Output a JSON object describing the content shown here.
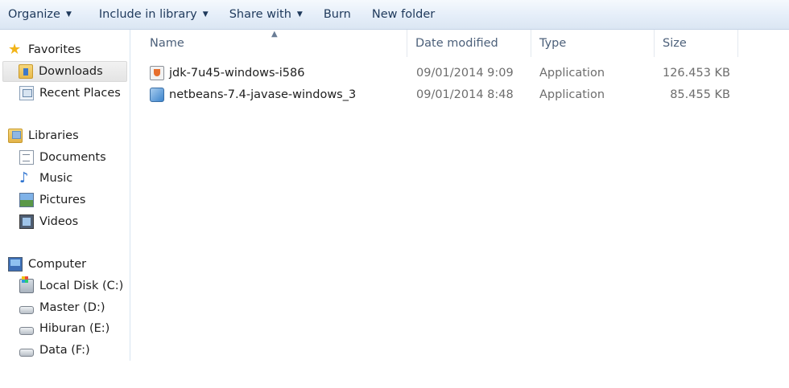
{
  "toolbar": {
    "organize": "Organize",
    "include_in_library": "Include in library",
    "share_with": "Share with",
    "burn": "Burn",
    "new_folder": "New folder"
  },
  "nav": {
    "favorites": {
      "header": "Favorites",
      "items": [
        {
          "label": "Downloads",
          "icon": "downloads-folder-icon",
          "selected": true
        },
        {
          "label": "Recent Places",
          "icon": "recent-places-icon",
          "selected": false
        }
      ]
    },
    "libraries": {
      "header": "Libraries",
      "items": [
        {
          "label": "Documents",
          "icon": "documents-icon"
        },
        {
          "label": "Music",
          "icon": "music-icon"
        },
        {
          "label": "Pictures",
          "icon": "pictures-icon"
        },
        {
          "label": "Videos",
          "icon": "videos-icon"
        }
      ]
    },
    "computer": {
      "header": "Computer",
      "items": [
        {
          "label": "Local Disk (C:)",
          "icon": "local-disk-icon"
        },
        {
          "label": "Master (D:)",
          "icon": "drive-icon"
        },
        {
          "label": "Hiburan (E:)",
          "icon": "drive-icon"
        },
        {
          "label": "Data (F:)",
          "icon": "drive-icon"
        }
      ]
    }
  },
  "columns": {
    "name": "Name",
    "date_modified": "Date modified",
    "type": "Type",
    "size": "Size",
    "sort_column": "name",
    "sort_direction": "ascending"
  },
  "files": [
    {
      "name": "jdk-7u45-windows-i586",
      "date_modified": "09/01/2014 9:09",
      "type": "Application",
      "size": "126.453 KB",
      "icon": "java-installer-icon"
    },
    {
      "name": "netbeans-7.4-javase-windows_3",
      "date_modified": "09/01/2014 8:48",
      "type": "Application",
      "size": "85.455 KB",
      "icon": "netbeans-installer-icon"
    }
  ],
  "colors": {
    "toolbar_text": "#1e395b",
    "header_text": "#4c607a",
    "secondary_text": "#6d6d6d",
    "nav_divider": "#d8e4f1"
  }
}
